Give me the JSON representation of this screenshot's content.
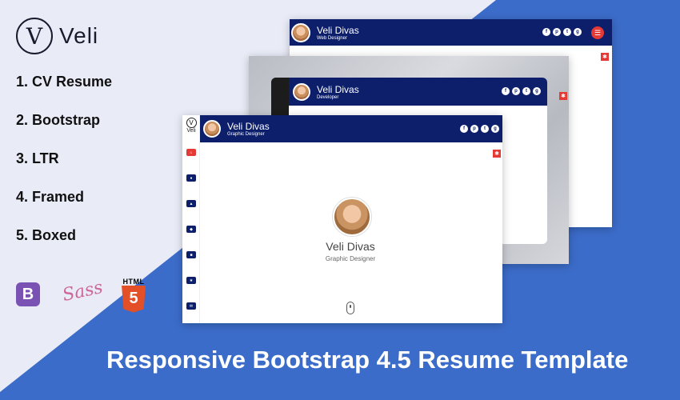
{
  "brand": {
    "mark": "V",
    "name": "Veli"
  },
  "features": [
    "1. CV Resume",
    "2. Bootstrap",
    "3. LTR",
    "4. Framed",
    "5. Boxed"
  ],
  "tech": {
    "bootstrap": "B",
    "sass": "Sass",
    "html_label": "HTML",
    "html_version": "5"
  },
  "tagline": "Responsive Bootstrap 4.5 Resume Template",
  "colors": {
    "navy": "#0d1f6b",
    "blue": "#3b6cc9",
    "red": "#e53935",
    "bg": "#e9ecf7"
  },
  "frames": [
    {
      "name": "Veli Divas",
      "role": "Web Designer"
    },
    {
      "name": "Veli Divas",
      "role": "Developer"
    },
    {
      "name": "Veli Divas",
      "role": "Graphic Designer"
    }
  ],
  "sidebar_logo": {
    "mark": "V",
    "text": "Veli"
  },
  "social_icons": [
    "facebook-icon",
    "pinterest-icon",
    "twitter-icon",
    "google-plus-icon"
  ],
  "hero": {
    "name": "Veli Divas",
    "role": "Graphic Designer"
  }
}
